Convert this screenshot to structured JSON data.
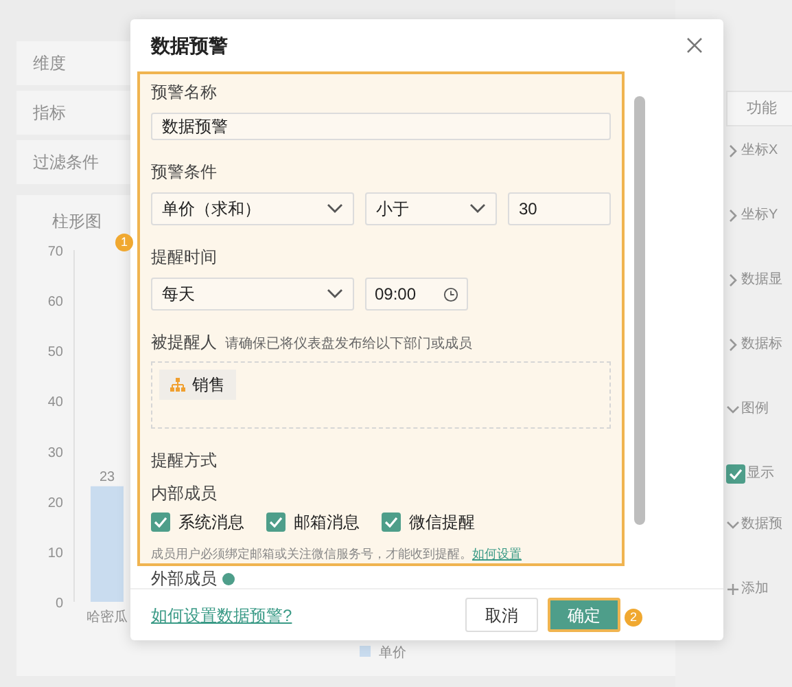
{
  "background": {
    "left_rows": [
      {
        "label": "维度"
      },
      {
        "label": "指标"
      },
      {
        "label": "过滤条件"
      }
    ],
    "chart": {
      "title": "柱形图",
      "chart_data": {
        "type": "bar",
        "categories": [
          "哈密瓜"
        ],
        "series": [
          {
            "name": "单价",
            "color": "#c9dcef",
            "values": [
              23
            ]
          }
        ],
        "ylim": [
          0,
          70
        ],
        "yticks": [
          0,
          10,
          20,
          30,
          40,
          50,
          60,
          70
        ],
        "data_labels": true
      }
    },
    "right_panel": {
      "button": "功能",
      "sections": [
        {
          "label": "坐标X",
          "expanded": false
        },
        {
          "label": "坐标Y",
          "expanded": false
        },
        {
          "label": "数据显",
          "expanded": false
        },
        {
          "label": "数据标",
          "expanded": false
        },
        {
          "label": "图例",
          "expanded": true
        },
        {
          "label": "显示",
          "kind": "checkbox",
          "checked": true
        },
        {
          "label": "数据预",
          "expanded": true
        },
        {
          "label": "添加",
          "kind": "add"
        }
      ]
    }
  },
  "dialog": {
    "title": "数据预警",
    "name_label": "预警名称",
    "name_value": "数据预警",
    "condition_label": "预警条件",
    "condition_field": "单价（求和）",
    "condition_operator": "小于",
    "condition_value": "30",
    "time_label": "提醒时间",
    "time_frequency": "每天",
    "time_value": "09:00",
    "recipients_label": "被提醒人",
    "recipients_hint": "请确保已将仪表盘发布给以下部门或成员",
    "recipients": [
      {
        "name": "销售"
      }
    ],
    "method_label": "提醒方式",
    "internal_label": "内部成员",
    "methods": [
      {
        "label": "系统消息",
        "checked": true
      },
      {
        "label": "邮箱消息",
        "checked": true
      },
      {
        "label": "微信提醒",
        "checked": true
      }
    ],
    "note": "成员用户必须绑定邮箱或关注微信服务号，才能收到提醒。",
    "note_link": "如何设置",
    "external_label": "外部成员",
    "help_link": "如何设置数据预警?",
    "cancel": "取消",
    "confirm": "确定",
    "callouts": [
      "1",
      "2"
    ]
  }
}
